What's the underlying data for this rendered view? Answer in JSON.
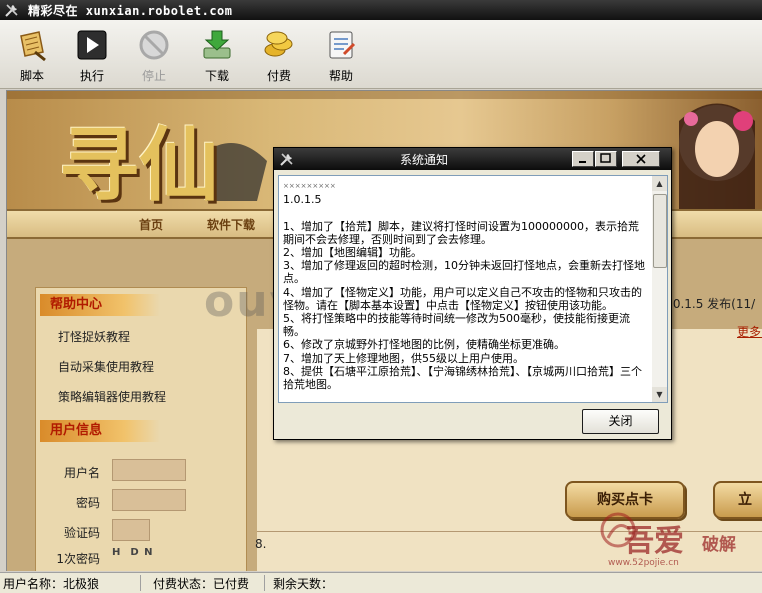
{
  "window": {
    "title": "精彩尽在 xunxian.robolet.com"
  },
  "toolbar": {
    "items": [
      {
        "label": "脚本",
        "icon": "scroll-icon"
      },
      {
        "label": "执行",
        "icon": "play-icon"
      },
      {
        "label": "停止",
        "icon": "stop-icon",
        "disabled": true
      },
      {
        "label": "下载",
        "icon": "download-icon"
      },
      {
        "label": "付费",
        "icon": "coins-icon"
      },
      {
        "label": "帮助",
        "icon": "help-notebook-icon"
      }
    ]
  },
  "banner": {
    "logo_text": "寻仙"
  },
  "nav": {
    "items": [
      "首页",
      "软件下载"
    ]
  },
  "left": {
    "help_title": "帮助中心",
    "help_items": [
      "打怪捉妖教程",
      "自动采集使用教程",
      "策略编辑器使用教程"
    ],
    "user_title": "用户信息",
    "fields": [
      {
        "label": "用户名"
      },
      {
        "label": "密码"
      },
      {
        "label": "验证码"
      }
    ],
    "captcha_text": "H  D N",
    "partial_label": "1次密码"
  },
  "right": {
    "news_partial": ".0.1.5 发布(11/",
    "more_link": "更多>",
    "buy_button": "购买点卡",
    "partial_button": "立",
    "item_number": "8."
  },
  "dialog": {
    "title": "系统通知",
    "content": "\n1.0.1.5\n\n1、增加了【拾荒】脚本，建议将打怪时间设置为100000000，表示拾荒期间不会去修理，否则时间到了会去修理。\n2、增加【地图编辑】功能。\n3、增加了修理返回的超时检测，10分钟未返回打怪地点，会重新去打怪地点。\n4、增加了【怪物定义】功能，用户可以定义自己不攻击的怪物和只攻击的怪物。请在【脚本基本设置】中点击【怪物定义】按钮使用该功能。\n5、将打怪策略中的技能等待时间统一修改为500毫秒，使技能衔接更流畅。\n6、修改了京城野外打怪地图的比例，使精确坐标更准确。\n7、增加了天上修理地图，供55级以上用户使用。\n8、提供【石塘平江原拾荒】、【宁海锦绣林拾荒】、【京城两川口拾荒】三个拾荒地图。",
    "close_label": "关闭",
    "stars": "×××××××××"
  },
  "statusbar": {
    "username": "用户名称：北极狼",
    "pay_status": "付费状态：已付费",
    "days_left": "剩余天数："
  },
  "watermark": {
    "center": "ouyaoxiazai",
    "logo_text": "吾爱",
    "logo_sub": "破解",
    "url": "www.52pojie.cn"
  },
  "colors": {
    "accent": "#b11a00",
    "titlebar": "#1a1a1a",
    "banner": "#d9b877"
  }
}
